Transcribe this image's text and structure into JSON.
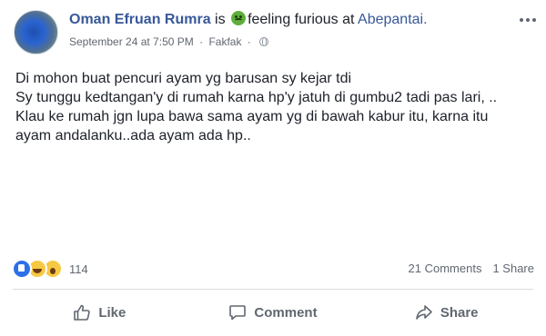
{
  "post": {
    "author": "Oman Efruan Rumra",
    "connector": "is",
    "feeling": "feeling furious at",
    "location": "Abepantai.",
    "feeling_icon": "angry-face-emoji",
    "date": "September 24 at 7:50 PM",
    "separator": "·",
    "place": "Fakfak",
    "privacy_icon": "globe-icon",
    "lines": [
      "Di mohon buat pencuri ayam yg barusan sy kejar tdi",
      "Sy tunggu kedtangan'y di rumah karna hp'y jatuh di gumbu2 tadi pas lari, ..",
      "Klau ke rumah jgn lupa bawa sama ayam yg di bawah kabur itu, karna itu",
      "ayam andalanku..ada ayam ada hp.."
    ]
  },
  "reactions": {
    "icons": [
      "like-reaction",
      "haha-reaction",
      "wow-reaction"
    ],
    "count": "114",
    "comments": "21 Comments",
    "shares": "1 Share"
  },
  "actions": {
    "like": "Like",
    "comment": "Comment",
    "share": "Share"
  },
  "colors": {
    "link": "#385898",
    "text": "#1d2129",
    "muted": "#606770",
    "like_blue": "#2d6fe7"
  }
}
